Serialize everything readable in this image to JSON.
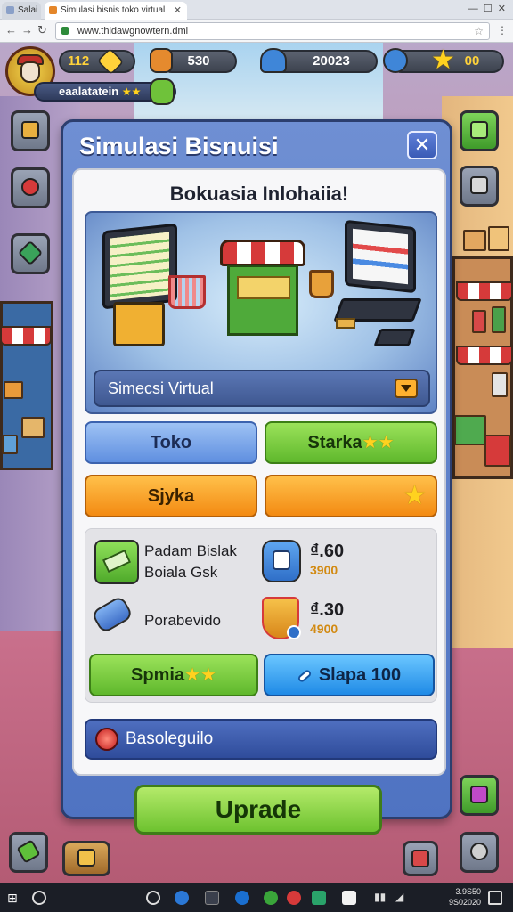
{
  "browser": {
    "tabs": [
      {
        "label": "Salai"
      },
      {
        "label": "Simulasi bisnis toko virtual"
      }
    ],
    "url": "www.thidawgnowtern.dml"
  },
  "hud": {
    "level": "112",
    "resource_1": "530",
    "resource_2": "20023",
    "stars": "00",
    "player_name": "eaalatatein"
  },
  "dialog": {
    "title": "Simulasi Bisnuisi",
    "subtitle": "Bokuasia Inlohaiia!",
    "sim_label": "Simecsi Virtual",
    "buttons": {
      "toko": "Toko",
      "starka": "Starka",
      "sjyka": "Sjyka"
    },
    "stats": {
      "item1_line1": "Padam Bislak",
      "item1_line2": "Boiala Gsk",
      "item1_value": "₫.60",
      "item1_sub": "3900",
      "item2_label": "Porabevido",
      "item2_value": "₫.30",
      "item2_sub": "4900"
    },
    "actions": {
      "spmia": "Spmia",
      "slapa": "Slapa 100"
    },
    "base_label": "Basoleguilo",
    "upgrade_label": "Uprade"
  },
  "taskbar": {
    "time": "3.9S50",
    "date": "9S02020"
  },
  "colors": {
    "dialog_blue": "#5a7ccc",
    "button_green": "#6dc22f",
    "button_orange": "#f38a12",
    "button_blue": "#5f8fe0"
  }
}
